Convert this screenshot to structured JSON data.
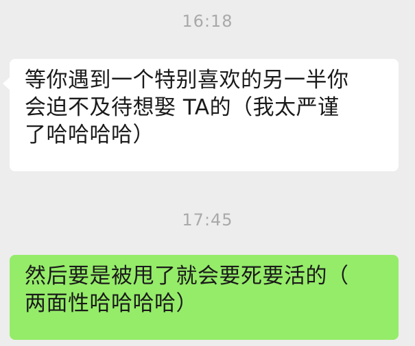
{
  "chat": {
    "timestamps": [
      "16:18",
      "17:45"
    ],
    "messages": [
      {
        "sender": "received",
        "text": "等你遇到一个特别喜欢的另一半你\n会迫不及待想娶 TA的（我太严谨\n了哈哈哈哈）"
      },
      {
        "sender": "sent",
        "text": "然后要是被甩了就会要死要活的（\n两面性哈哈哈哈）"
      }
    ]
  },
  "colors": {
    "background": "#ededed",
    "timestamp": "#a9a9a9",
    "received_bubble": "#ffffff",
    "sent_bubble": "#95ec69",
    "message_text": "#1a1a1a"
  }
}
